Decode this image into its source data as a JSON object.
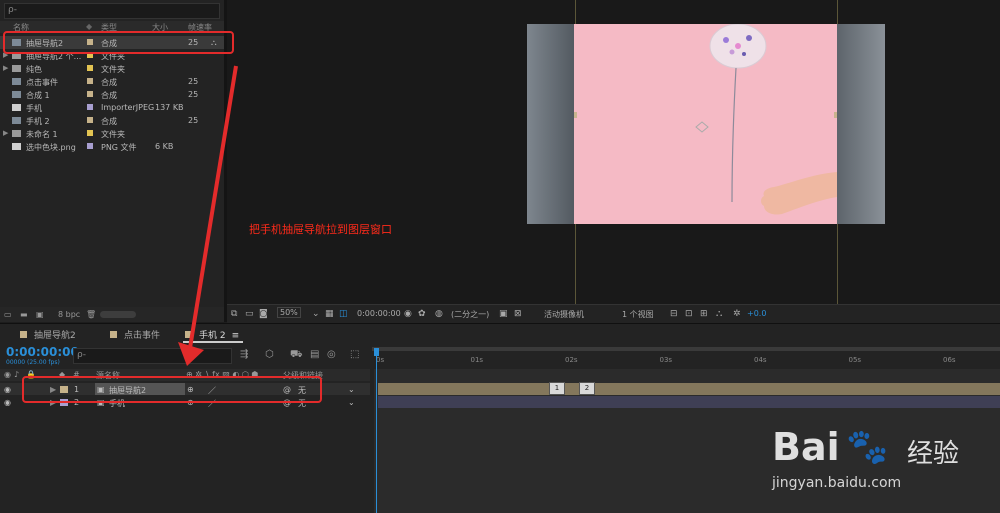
{
  "project": {
    "search_placeholder": "ρ-",
    "columns": {
      "name": "名称",
      "type": "类型",
      "size": "大小",
      "framerate": "帧速率"
    },
    "items": [
      {
        "name": "抽屉导航2",
        "type": "合成",
        "size": "",
        "fps": "25",
        "kind": "comp",
        "label": "#c6b28a",
        "selected": true,
        "expand": ""
      },
      {
        "name": "抽屉导航2 个...",
        "type": "文件夹",
        "size": "",
        "fps": "",
        "kind": "folder",
        "label": "#e3c452",
        "expand": "▶"
      },
      {
        "name": "纯色",
        "type": "文件夹",
        "size": "",
        "fps": "",
        "kind": "folder",
        "label": "#e3c452",
        "expand": "▶"
      },
      {
        "name": "点击事件",
        "type": "合成",
        "size": "",
        "fps": "25",
        "kind": "comp",
        "label": "#c6b28a",
        "expand": ""
      },
      {
        "name": "合成 1",
        "type": "合成",
        "size": "",
        "fps": "25",
        "kind": "comp",
        "label": "#c6b28a",
        "expand": ""
      },
      {
        "name": "手机",
        "type": "ImporterJPEG",
        "size": "137 KB",
        "fps": "",
        "kind": "file",
        "label": "#a89fd0",
        "expand": ""
      },
      {
        "name": "手机 2",
        "type": "合成",
        "size": "",
        "fps": "25",
        "kind": "comp",
        "label": "#c6b28a",
        "expand": ""
      },
      {
        "name": "未命名 1",
        "type": "文件夹",
        "size": "",
        "fps": "",
        "kind": "folder",
        "label": "#e3c452",
        "expand": "▶"
      },
      {
        "name": "选中色块.png",
        "type": "PNG 文件",
        "size": "6 KB",
        "fps": "",
        "kind": "file",
        "label": "#a89fd0",
        "expand": ""
      }
    ],
    "bpc": "8 bpc"
  },
  "viewer": {
    "zoom": "50%",
    "timecode": "0:00:00:00",
    "resolution": "(二分之一)",
    "camera": "活动摄像机",
    "views": "1 个视图",
    "exposure": "+0.0",
    "annotation": "把手机抽屉导航拉到图层窗口"
  },
  "timeline": {
    "tabs": [
      {
        "label": "抽屉导航2",
        "color": "#c6b28a"
      },
      {
        "label": "点击事件",
        "color": "#c6b28a"
      },
      {
        "label": "手机 2",
        "color": "#c6b28a"
      }
    ],
    "timecode": "0:00:00:00",
    "fps_line": "00000 (25.00 fps)",
    "search_placeholder": "ρ-",
    "header": {
      "num": "#",
      "source_name": "源名称",
      "parent": "父级和链接"
    },
    "layers": [
      {
        "num": "1",
        "name": "抽屉导航2",
        "parent": "无",
        "color": "#c6b28a",
        "selected": true
      },
      {
        "num": "2",
        "name": "手机",
        "parent": "无",
        "color": "#a89fd0",
        "selected": false
      }
    ],
    "ruler": [
      "0s",
      "01s",
      "02s",
      "03s",
      "04s",
      "05s",
      "06s"
    ],
    "markers": [
      "1",
      "2"
    ]
  },
  "watermark": {
    "brand": "Bai",
    "brand2": "经验",
    "url": "jingyan.baidu.com"
  },
  "colors": {
    "accent": "#2a8fd8",
    "highlight": "#e32b2b",
    "pink": "#f5bac5"
  }
}
